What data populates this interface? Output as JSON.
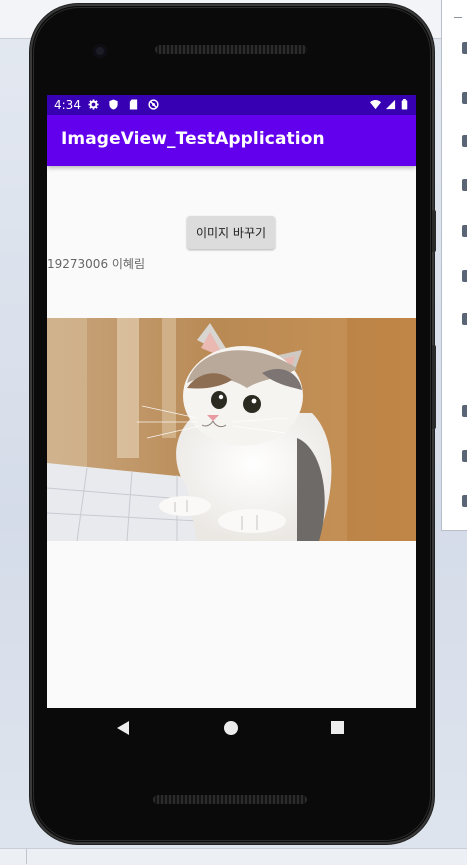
{
  "status_bar": {
    "time": "4:34",
    "background_color": "#3700b3",
    "left_icons": [
      "gear-icon",
      "shield-icon",
      "sd-card-icon",
      "no-sync-icon"
    ],
    "right_icons": [
      "wifi-icon",
      "signal-icon",
      "battery-icon"
    ]
  },
  "app_bar": {
    "title": "ImageView_TestApplication",
    "background_color": "#6200ee"
  },
  "main": {
    "change_image_button_label": "이미지 바꾸기",
    "student_text": "19273006 이혜림",
    "image": "cat-photo"
  },
  "nav_bar": {
    "buttons": [
      "back-icon",
      "home-icon",
      "recents-icon"
    ]
  }
}
